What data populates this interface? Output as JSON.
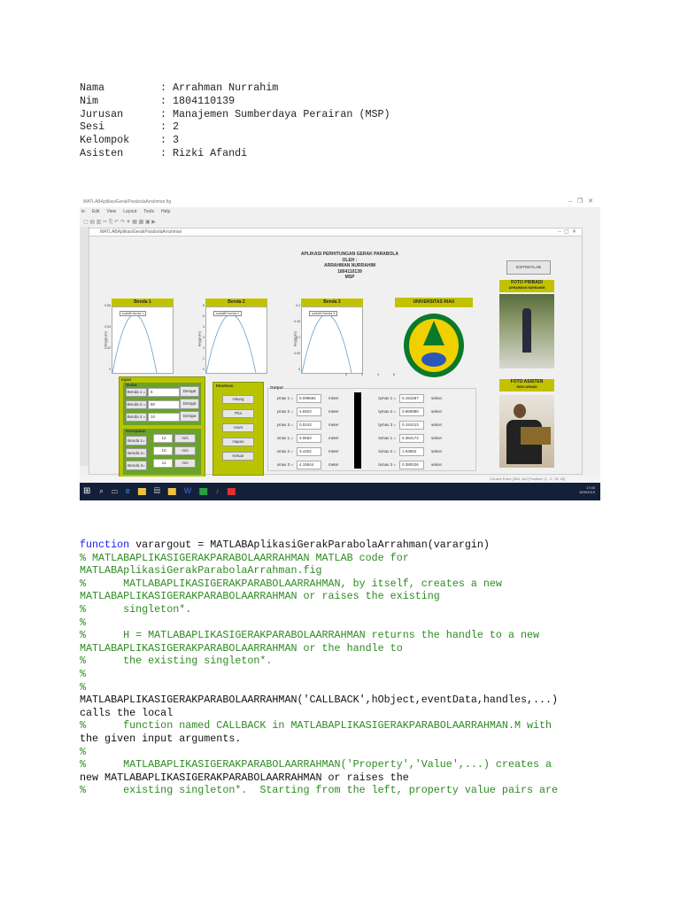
{
  "info": [
    {
      "label": "Nama",
      "value": "Arrahman Nurrahim"
    },
    {
      "label": "Nim",
      "value": "1804110139"
    },
    {
      "label": "Jurusan",
      "value": "Manajemen Sumberdaya Perairan (MSP)"
    },
    {
      "label": "Sesi",
      "value": "2"
    },
    {
      "label": "Kelompok",
      "value": "3"
    },
    {
      "label": "Asisten",
      "value": "Rizki Afandi"
    }
  ],
  "screenshot": {
    "outer_title": "MATLABAplikasiGerakParabolaArrahman.fig",
    "menu": [
      "le",
      "Edit",
      "View",
      "Layout",
      "Tools",
      "Help"
    ],
    "inner_title": "MATLABAplikasiGerakParabolaArrahman",
    "header": [
      "APLIKASI PERHITUNGAN GERAK PARABOLA",
      "OLEH :",
      "ARRAHMAN NURRAHIM",
      "1804110139",
      "MSP"
    ],
    "exit_button": "EXITMATLAB",
    "foto_pribadi": [
      "FOTO PRIBADI",
      "ARRAHMAN NURRAHIM"
    ],
    "foto_asisten": [
      "FOTO ASISTEN",
      "RIZKI AFANDI"
    ],
    "university": "UNIVERSITAS RIAU",
    "plots": [
      {
        "title": "Benda 1",
        "legend": "sudut5 benda 1",
        "ylabel": "tinggi (m)",
        "yticks": [
          "0.06",
          "0.04",
          "0.02",
          "0"
        ]
      },
      {
        "title": "Benda 2",
        "legend": "sudut80 benda 2",
        "ylabel": "tinggi (m)",
        "yticks": [
          "6",
          "5",
          "4",
          "3",
          "2",
          "1",
          "0"
        ]
      },
      {
        "title": "Benda 3",
        "legend": "sudut10 benda 3",
        "ylabel": "tinggi (m)",
        "yticks": [
          "0.2",
          "0.15",
          "0.1",
          "0.05",
          "0"
        ]
      }
    ],
    "xticks": [
      "0",
      "2",
      "4",
      "6"
    ],
    "input": {
      "title": "Input",
      "sudut_title": "Sudut",
      "sudut": [
        {
          "label": "Benda 1 =",
          "value": "5",
          "unit": "Derajat"
        },
        {
          "label": "Benda 2 =",
          "value": "80",
          "unit": "Derajat"
        },
        {
          "label": "Benda 3 =",
          "value": "10",
          "unit": "Derajat"
        }
      ],
      "kec_title": "Kecepatan",
      "kec": [
        {
          "label": "Benda 1=",
          "value": "12",
          "unit": "m/s"
        },
        {
          "label": "Benda 2=",
          "value": "10",
          "unit": "m/s"
        },
        {
          "label": "Benda 3=",
          "value": "11",
          "unit": "m/s"
        }
      ]
    },
    "eksekusi": {
      "title": "Eksekusi",
      "buttons": [
        "Hitung",
        "Plot",
        "reset",
        "Hapus",
        "Keluar"
      ]
    },
    "output": {
      "title": "Output",
      "left": [
        {
          "label": "ymax 1 =",
          "value": "0.098692",
          "unit": "meter"
        },
        {
          "label": "ymax 2 =",
          "value": "4.6923",
          "unit": "meter"
        },
        {
          "label": "ymax 3 =",
          "value": "0.0243",
          "unit": "meter"
        },
        {
          "label": "xmax 1 =",
          "value": "3.0663",
          "unit": "meter"
        },
        {
          "label": "xmax 2 =",
          "value": "3.4202",
          "unit": "meter"
        },
        {
          "label": "xmax 3 =",
          "value": "4.15844",
          "unit": "meter"
        }
      ],
      "right": [
        {
          "label": "tymax 1 =",
          "value": "0.191587",
          "unit": "sekon"
        },
        {
          "label": "tymax 2 =",
          "value": "0.969980",
          "unit": "sekon"
        },
        {
          "label": "tymax 3 =",
          "value": "0.191013",
          "unit": "sekon"
        },
        {
          "label": "txmax 1 =",
          "value": "0.384174",
          "unit": "sekon"
        },
        {
          "label": "txmax 2 =",
          "value": "1.93962",
          "unit": "sekon"
        },
        {
          "label": "txmax 3 =",
          "value": "0.380026",
          "unit": "sekon"
        }
      ]
    },
    "status": "Current Point: [354, 161]   Position: [1, -2, 78, 25]",
    "clock": [
      "17:40",
      "3/05/2019"
    ]
  },
  "code": [
    {
      "cls": "k",
      "text": "function",
      "rest": " varargout = MATLABAplikasiGerakParabolaArrahman(varargin)"
    },
    {
      "cls": "c",
      "text": "% MATLABAPLIKASIGERAKPARABOLAARRAHMAN MATLAB code for"
    },
    {
      "cls": "c",
      "text": "MATLABAplikasiGerakParabolaArrahman.fig"
    },
    {
      "cls": "c",
      "text": "%      MATLABAPLIKASIGERAKPARABOLAARRAHMAN, by itself, creates a new"
    },
    {
      "cls": "c",
      "text": "MATLABAPLIKASIGERAKPARABOLAARRAHMAN or raises the existing"
    },
    {
      "cls": "c",
      "text": "%      singleton*."
    },
    {
      "cls": "c",
      "text": "%"
    },
    {
      "cls": "c",
      "text": "%      H = MATLABAPLIKASIGERAKPARABOLAARRAHMAN returns the handle to a new"
    },
    {
      "cls": "c",
      "text": "MATLABAPLIKASIGERAKPARABOLAARRAHMAN or the handle to"
    },
    {
      "cls": "c",
      "text": "%      the existing singleton*."
    },
    {
      "cls": "c",
      "text": "%"
    },
    {
      "cls": "c",
      "text": "%"
    },
    {
      "cls": "t",
      "text": "MATLABAPLIKASIGERAKPARABOLAARRAHMAN('CALLBACK',hObject,eventData,handles,...)"
    },
    {
      "cls": "t",
      "text": "calls the local"
    },
    {
      "cls": "c",
      "text": "%      function named CALLBACK in MATLABAPLIKASIGERAKPARABOLAARRAHMAN.M with"
    },
    {
      "cls": "t",
      "text": "the given input arguments."
    },
    {
      "cls": "c",
      "text": "%"
    },
    {
      "cls": "c",
      "text": "%      MATLABAPLIKASIGERAKPARABOLAARRAHMAN('Property','Value',...) creates a"
    },
    {
      "cls": "t",
      "text": "new MATLABAPLIKASIGERAKPARABOLAARRAHMAN or raises the"
    },
    {
      "cls": "c",
      "text": "%      existing singleton*.  Starting from the left, property value pairs are"
    }
  ]
}
